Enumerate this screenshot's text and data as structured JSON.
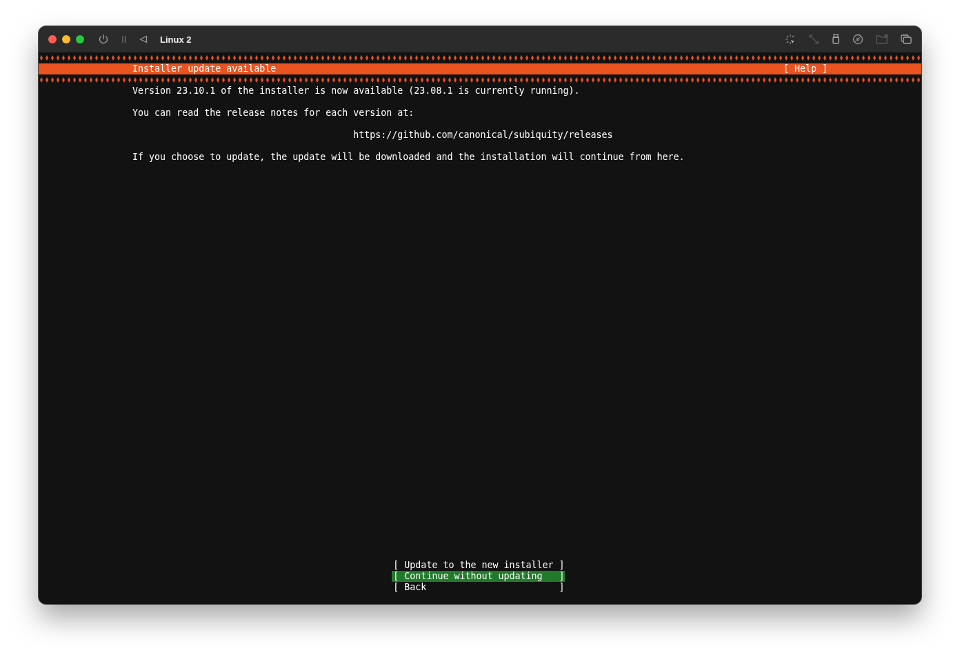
{
  "window": {
    "title": "Linux 2"
  },
  "header": {
    "title": "Installer update available",
    "help": "[ Help ]"
  },
  "body": [
    {
      "kind": "text",
      "text": "Version 23.10.1 of the installer is now available (23.08.1 is currently running)."
    },
    {
      "kind": "text",
      "text": "You can read the release notes for each version at:"
    },
    {
      "kind": "link",
      "text": "https://github.com/canonical/subiquity/releases"
    },
    {
      "kind": "text",
      "text": "If you choose to update, the update will be downloaded and the installation will continue from here."
    }
  ],
  "buttons": [
    {
      "label": "[ Update to the new installer ]",
      "selected": false
    },
    {
      "label": "[ Continue without updating   ]",
      "selected": true
    },
    {
      "label": "[ Back                        ]",
      "selected": false
    }
  ]
}
